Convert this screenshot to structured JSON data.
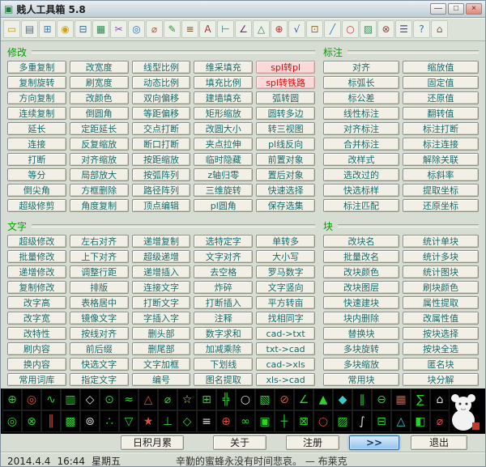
{
  "window": {
    "title": "贱人工具箱 5.8"
  },
  "titlebar": {
    "app_icon_glyph": "▣",
    "controls": [
      {
        "name": "minimize-button",
        "glyph": "—"
      },
      {
        "name": "maximize-button",
        "glyph": "□"
      },
      {
        "name": "close-button",
        "glyph": "×"
      }
    ]
  },
  "colors": {
    "header_green": "#00a000",
    "button_text_teal": "#186a6a",
    "hot_button_bg": "#fcd9d9",
    "hot_button_text": "#cc1111",
    "palette_bg": "#000000"
  },
  "toolbar": {
    "icons": [
      {
        "name": "open-folder-icon",
        "glyph": "▭",
        "color": "#c8991f"
      },
      {
        "name": "print-icon",
        "glyph": "▤",
        "color": "#5a6b7a"
      },
      {
        "name": "print-preview-icon",
        "glyph": "⊞",
        "color": "#3f7fbf"
      },
      {
        "name": "lock-icon",
        "glyph": "◉",
        "color": "#c9a227"
      },
      {
        "name": "calculator-icon",
        "glyph": "⊟",
        "color": "#35689a"
      },
      {
        "name": "table-icon",
        "glyph": "▦",
        "color": "#2e8b57"
      },
      {
        "name": "cut-icon",
        "glyph": "✂",
        "color": "#8a4fb0"
      },
      {
        "name": "zoom-icon",
        "glyph": "◎",
        "color": "#2f6fae"
      },
      {
        "name": "measure-icon",
        "glyph": "⌀",
        "color": "#b0582f"
      },
      {
        "name": "pencil-icon",
        "glyph": "✎",
        "color": "#3d8f3d"
      },
      {
        "name": "layers-icon",
        "glyph": "≡",
        "color": "#70522e"
      },
      {
        "name": "text-icon",
        "glyph": "A",
        "color": "#b03030"
      },
      {
        "name": "dimension-icon",
        "glyph": "⊢",
        "color": "#2d7d7d"
      },
      {
        "name": "angle-icon",
        "glyph": "∠",
        "color": "#7d2d7d"
      },
      {
        "name": "area-icon",
        "glyph": "△",
        "color": "#2d7d4d"
      },
      {
        "name": "coordinate-icon",
        "glyph": "⊕",
        "color": "#b0302f"
      },
      {
        "name": "match-icon",
        "glyph": "√",
        "color": "#2d5d9d"
      },
      {
        "name": "block-icon",
        "glyph": "⊡",
        "color": "#8a6d2f"
      },
      {
        "name": "polyline-icon",
        "glyph": "╱",
        "color": "#3a7dbf"
      },
      {
        "name": "circle-icon",
        "glyph": "○",
        "color": "#bf3a3a"
      },
      {
        "name": "hatch-icon",
        "glyph": "▨",
        "color": "#3a8a5a"
      },
      {
        "name": "purge-icon",
        "glyph": "⊗",
        "color": "#9a3a3a"
      },
      {
        "name": "settings-icon",
        "glyph": "☰",
        "color": "#4a4a8a"
      },
      {
        "name": "help-icon",
        "glyph": "?",
        "color": "#2f6fae"
      },
      {
        "name": "home-icon",
        "glyph": "⌂",
        "color": "#8a5a2f"
      }
    ]
  },
  "sections": {
    "modify": {
      "label": "修改",
      "columns": 5,
      "buttons": [
        "多重复制",
        "改宽度",
        "线型比例",
        "维采填充",
        {
          "label": "spl转pl",
          "hot": true
        },
        "复制旋转",
        "刷宽度",
        "动态比例",
        "填充比例",
        {
          "label": "spl转铁路",
          "hot": true
        },
        "方向复制",
        "改颜色",
        "双向偏移",
        "建墙填充",
        "弧转圆",
        "连续复制",
        "倒圆角",
        "等距偏移",
        "矩形缩放",
        "圆转多边",
        "延长",
        "定距延长",
        "交点打断",
        "改圆大小",
        "转三视图",
        "连接",
        "反复缩放",
        "断口打断",
        "夹点拉伸",
        "pl线反向",
        "打断",
        "对齐缩放",
        "按距缩放",
        "临时隐藏",
        "前置对象",
        "等分",
        "局部放大",
        "按弧阵列",
        "z轴归零",
        "置后对象",
        "倒尖角",
        "方框删除",
        "路径阵列",
        "三维旋转",
        "快速选择",
        "超级修剪",
        "角度复制",
        "顶点编辑",
        "pl圆角",
        "保存选集"
      ]
    },
    "dimension": {
      "label": "标注",
      "columns": 2,
      "buttons": [
        "对齐",
        "缩放值",
        "标弧长",
        "固定值",
        "标公差",
        "还原值",
        "线性标注",
        "翻转值",
        "对齐标注",
        "标注打断",
        "合并标注",
        "标注连接",
        "改样式",
        "解除关联",
        "选改过的",
        "标斜率",
        "快选标样",
        "提取坐标",
        "标注匹配",
        "还原坐标"
      ]
    },
    "text": {
      "label": "文字",
      "columns": 5,
      "buttons": [
        "超级修改",
        "左右对齐",
        "递增复制",
        "选特定字",
        "单转多",
        "批量修改",
        "上下对齐",
        "超级递增",
        "文字对齐",
        "大小写",
        "递增修改",
        "调整行距",
        "递增插入",
        "去空格",
        "罗马数字",
        "复制修改",
        "排版",
        "连接文字",
        "炸碎",
        "文字竖向",
        "改字高",
        "表格居中",
        "打断文字",
        "打断插入",
        "平方转亩",
        "改字宽",
        "镜像文字",
        "字插入字",
        "注释",
        "找相同字",
        "改特性",
        "按线对齐",
        "删头部",
        "数字求和",
        "cad->txt",
        "刷内容",
        "前后缀",
        "删尾部",
        "加减乘除",
        "txt->cad",
        "换内容",
        "快选文字",
        "文字加框",
        "下划线",
        "cad->xls",
        "常用词库",
        "指定文字",
        "编号",
        "图名提取",
        "xls->cad"
      ]
    },
    "block": {
      "label": "块",
      "columns": 2,
      "buttons": [
        "改块名",
        "统计单块",
        "批量改名",
        "统计多块",
        "改块颜色",
        "统计图块",
        "改块图层",
        "刷块颜色",
        "快速建块",
        "属性提取",
        "块内删除",
        "改属性值",
        "替换块",
        "按块选择",
        "多块旋转",
        "按块全选",
        "多块缩放",
        "匿名块",
        "常用块",
        "块分解"
      ]
    }
  },
  "icon_panel": {
    "rows": [
      [
        {
          "g": "⊕",
          "c": "#2bd42b"
        },
        {
          "g": "◎",
          "c": "#e0503a"
        },
        {
          "g": "∿",
          "c": "#2bd42b"
        },
        {
          "g": "▥",
          "c": "#2bd42b"
        },
        {
          "g": "◇",
          "c": "#dcdcdc"
        },
        {
          "g": "⊙",
          "c": "#2bd42b"
        },
        {
          "g": "≈",
          "c": "#2bd42b"
        },
        {
          "g": "△",
          "c": "#e0503a"
        },
        {
          "g": "⌀",
          "c": "#2bd42b"
        },
        {
          "g": "☆",
          "c": "#d8d84a"
        },
        {
          "g": "⊞",
          "c": "#2bd42b"
        },
        {
          "g": "╬",
          "c": "#2bd42b"
        },
        {
          "g": "○",
          "c": "#dcdcdc"
        },
        {
          "g": "▧",
          "c": "#2bd42b"
        },
        {
          "g": "⊘",
          "c": "#e0503a"
        },
        {
          "g": "∠",
          "c": "#2bd42b"
        },
        {
          "g": "▲",
          "c": "#2bd42b"
        },
        {
          "g": "◆",
          "c": "#3ac8c8"
        },
        {
          "g": "∥",
          "c": "#2bd42b"
        },
        {
          "g": "⊖",
          "c": "#2bd42b"
        },
        {
          "g": "▦",
          "c": "#e0503a"
        },
        {
          "g": "∑",
          "c": "#2bd42b"
        },
        {
          "g": "⌂",
          "c": "#dcdcdc"
        }
      ],
      [
        {
          "g": "◎",
          "c": "#2bd42b"
        },
        {
          "g": "⊗",
          "c": "#2bd42b"
        },
        {
          "g": "║",
          "c": "#e0503a"
        },
        {
          "g": "▩",
          "c": "#2bd42b"
        },
        {
          "g": "⊚",
          "c": "#dcdcdc"
        },
        {
          "g": "∴",
          "c": "#2bd42b"
        },
        {
          "g": "▽",
          "c": "#2bd42b"
        },
        {
          "g": "★",
          "c": "#e0503a"
        },
        {
          "g": "⊥",
          "c": "#2bd42b"
        },
        {
          "g": "◇",
          "c": "#2bd42b"
        },
        {
          "g": "≡",
          "c": "#dcdcdc"
        },
        {
          "g": "⊕",
          "c": "#e0503a"
        },
        {
          "g": "∞",
          "c": "#2bd42b"
        },
        {
          "g": "▣",
          "c": "#2bd42b"
        },
        {
          "g": "┼",
          "c": "#2bd42b"
        },
        {
          "g": "⊠",
          "c": "#2bd42b"
        },
        {
          "g": "○",
          "c": "#e0503a"
        },
        {
          "g": "▨",
          "c": "#2bd42b"
        },
        {
          "g": "∫",
          "c": "#dcdcdc"
        },
        {
          "g": "⊟",
          "c": "#2bd42b"
        },
        {
          "g": "△",
          "c": "#3ac8c8"
        },
        {
          "g": "◧",
          "c": "#2bd42b"
        },
        {
          "g": "⌀",
          "c": "#e0503a"
        }
      ]
    ]
  },
  "footer": {
    "buttons": [
      {
        "name": "daily-button",
        "label": "日积月累"
      },
      {
        "name": "about-button",
        "label": "关于"
      },
      {
        "name": "register-button",
        "label": "注册"
      },
      {
        "name": "more-button",
        "label": ">>",
        "highlight": true
      },
      {
        "name": "exit-button",
        "label": "退出"
      }
    ],
    "date": "2014.4.4",
    "time": "16:44",
    "weekday": "星期五",
    "quote": "辛勤的蜜蜂永没有时间悲哀。 — 布莱克"
  }
}
